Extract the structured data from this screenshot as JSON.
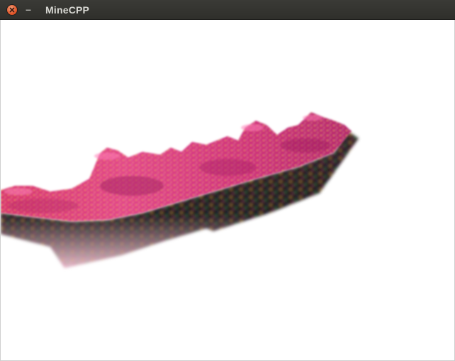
{
  "window": {
    "title": "MineCPP",
    "close_icon": "close-icon",
    "minimize_label": "–",
    "colors": {
      "titlebar": "#32322e",
      "close": "#e2572a",
      "viewport_bg": "#ffffff"
    }
  },
  "scene": {
    "content": "voxel-terrain-render",
    "colors": {
      "surface_pink": "#e23d8f",
      "surface_magenta": "#c7267a",
      "highlight_orange": "#f4a93a",
      "side_dark": "#1a0f12"
    }
  }
}
